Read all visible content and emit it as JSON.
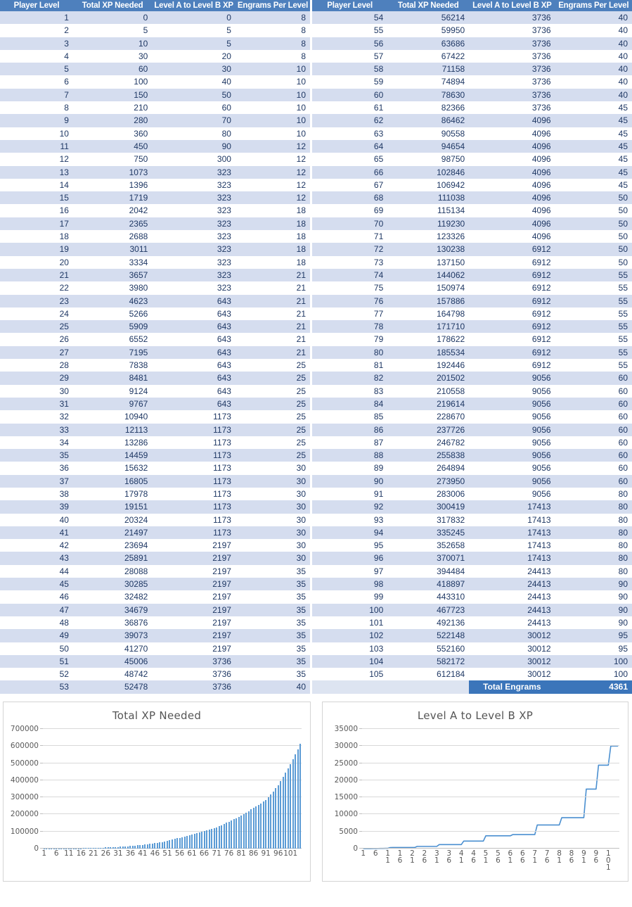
{
  "tables": {
    "headers": [
      "Player Level",
      "Total XP Needed",
      "Level A to Level B XP",
      "Engrams Per Level"
    ],
    "left_rows": [
      [
        1,
        0,
        0,
        8
      ],
      [
        2,
        5,
        5,
        8
      ],
      [
        3,
        10,
        5,
        8
      ],
      [
        4,
        30,
        20,
        8
      ],
      [
        5,
        60,
        30,
        10
      ],
      [
        6,
        100,
        40,
        10
      ],
      [
        7,
        150,
        50,
        10
      ],
      [
        8,
        210,
        60,
        10
      ],
      [
        9,
        280,
        70,
        10
      ],
      [
        10,
        360,
        80,
        10
      ],
      [
        11,
        450,
        90,
        12
      ],
      [
        12,
        750,
        300,
        12
      ],
      [
        13,
        1073,
        323,
        12
      ],
      [
        14,
        1396,
        323,
        12
      ],
      [
        15,
        1719,
        323,
        12
      ],
      [
        16,
        2042,
        323,
        18
      ],
      [
        17,
        2365,
        323,
        18
      ],
      [
        18,
        2688,
        323,
        18
      ],
      [
        19,
        3011,
        323,
        18
      ],
      [
        20,
        3334,
        323,
        18
      ],
      [
        21,
        3657,
        323,
        21
      ],
      [
        22,
        3980,
        323,
        21
      ],
      [
        23,
        4623,
        643,
        21
      ],
      [
        24,
        5266,
        643,
        21
      ],
      [
        25,
        5909,
        643,
        21
      ],
      [
        26,
        6552,
        643,
        21
      ],
      [
        27,
        7195,
        643,
        21
      ],
      [
        28,
        7838,
        643,
        25
      ],
      [
        29,
        8481,
        643,
        25
      ],
      [
        30,
        9124,
        643,
        25
      ],
      [
        31,
        9767,
        643,
        25
      ],
      [
        32,
        10940,
        1173,
        25
      ],
      [
        33,
        12113,
        1173,
        25
      ],
      [
        34,
        13286,
        1173,
        25
      ],
      [
        35,
        14459,
        1173,
        25
      ],
      [
        36,
        15632,
        1173,
        30
      ],
      [
        37,
        16805,
        1173,
        30
      ],
      [
        38,
        17978,
        1173,
        30
      ],
      [
        39,
        19151,
        1173,
        30
      ],
      [
        40,
        20324,
        1173,
        30
      ],
      [
        41,
        21497,
        1173,
        30
      ],
      [
        42,
        23694,
        2197,
        30
      ],
      [
        43,
        25891,
        2197,
        30
      ],
      [
        44,
        28088,
        2197,
        35
      ],
      [
        45,
        30285,
        2197,
        35
      ],
      [
        46,
        32482,
        2197,
        35
      ],
      [
        47,
        34679,
        2197,
        35
      ],
      [
        48,
        36876,
        2197,
        35
      ],
      [
        49,
        39073,
        2197,
        35
      ],
      [
        50,
        41270,
        2197,
        35
      ],
      [
        51,
        45006,
        3736,
        35
      ],
      [
        52,
        48742,
        3736,
        35
      ],
      [
        53,
        52478,
        3736,
        40
      ]
    ],
    "right_rows": [
      [
        54,
        56214,
        3736,
        40
      ],
      [
        55,
        59950,
        3736,
        40
      ],
      [
        56,
        63686,
        3736,
        40
      ],
      [
        57,
        67422,
        3736,
        40
      ],
      [
        58,
        71158,
        3736,
        40
      ],
      [
        59,
        74894,
        3736,
        40
      ],
      [
        60,
        78630,
        3736,
        40
      ],
      [
        61,
        82366,
        3736,
        45
      ],
      [
        62,
        86462,
        4096,
        45
      ],
      [
        63,
        90558,
        4096,
        45
      ],
      [
        64,
        94654,
        4096,
        45
      ],
      [
        65,
        98750,
        4096,
        45
      ],
      [
        66,
        102846,
        4096,
        45
      ],
      [
        67,
        106942,
        4096,
        45
      ],
      [
        68,
        111038,
        4096,
        50
      ],
      [
        69,
        115134,
        4096,
        50
      ],
      [
        70,
        119230,
        4096,
        50
      ],
      [
        71,
        123326,
        4096,
        50
      ],
      [
        72,
        130238,
        6912,
        50
      ],
      [
        73,
        137150,
        6912,
        50
      ],
      [
        74,
        144062,
        6912,
        55
      ],
      [
        75,
        150974,
        6912,
        55
      ],
      [
        76,
        157886,
        6912,
        55
      ],
      [
        77,
        164798,
        6912,
        55
      ],
      [
        78,
        171710,
        6912,
        55
      ],
      [
        79,
        178622,
        6912,
        55
      ],
      [
        80,
        185534,
        6912,
        55
      ],
      [
        81,
        192446,
        6912,
        55
      ],
      [
        82,
        201502,
        9056,
        60
      ],
      [
        83,
        210558,
        9056,
        60
      ],
      [
        84,
        219614,
        9056,
        60
      ],
      [
        85,
        228670,
        9056,
        60
      ],
      [
        86,
        237726,
        9056,
        60
      ],
      [
        87,
        246782,
        9056,
        60
      ],
      [
        88,
        255838,
        9056,
        60
      ],
      [
        89,
        264894,
        9056,
        60
      ],
      [
        90,
        273950,
        9056,
        60
      ],
      [
        91,
        283006,
        9056,
        80
      ],
      [
        92,
        300419,
        17413,
        80
      ],
      [
        93,
        317832,
        17413,
        80
      ],
      [
        94,
        335245,
        17413,
        80
      ],
      [
        95,
        352658,
        17413,
        80
      ],
      [
        96,
        370071,
        17413,
        80
      ],
      [
        97,
        394484,
        24413,
        80
      ],
      [
        98,
        418897,
        24413,
        90
      ],
      [
        99,
        443310,
        24413,
        90
      ],
      [
        100,
        467723,
        24413,
        90
      ],
      [
        101,
        492136,
        24413,
        90
      ],
      [
        102,
        522148,
        30012,
        95
      ],
      [
        103,
        552160,
        30012,
        95
      ],
      [
        104,
        582172,
        30012,
        100
      ],
      [
        105,
        612184,
        30012,
        100
      ]
    ],
    "total_label": "Total Engrams",
    "total_value": "4361",
    "header_bg": "#4e80bd",
    "row_alt_bg": "#d5ddef",
    "text_color": "#1f3864",
    "total_bg": "#3b75ba"
  },
  "chart_data": [
    {
      "type": "bar",
      "title": "Total XP Needed",
      "xlabel": "",
      "ylabel": "",
      "ylim": [
        0,
        700000
      ],
      "yticks": [
        0,
        100000,
        200000,
        300000,
        400000,
        500000,
        600000,
        700000
      ],
      "xticks": [
        1,
        6,
        11,
        16,
        21,
        26,
        31,
        36,
        41,
        46,
        51,
        56,
        61,
        66,
        71,
        76,
        81,
        86,
        91,
        96,
        101
      ],
      "grid": true,
      "legend": "none",
      "series_color": "#5b9bd5",
      "categories": [
        1,
        2,
        3,
        4,
        5,
        6,
        7,
        8,
        9,
        10,
        11,
        12,
        13,
        14,
        15,
        16,
        17,
        18,
        19,
        20,
        21,
        22,
        23,
        24,
        25,
        26,
        27,
        28,
        29,
        30,
        31,
        32,
        33,
        34,
        35,
        36,
        37,
        38,
        39,
        40,
        41,
        42,
        43,
        44,
        45,
        46,
        47,
        48,
        49,
        50,
        51,
        52,
        53,
        54,
        55,
        56,
        57,
        58,
        59,
        60,
        61,
        62,
        63,
        64,
        65,
        66,
        67,
        68,
        69,
        70,
        71,
        72,
        73,
        74,
        75,
        76,
        77,
        78,
        79,
        80,
        81,
        82,
        83,
        84,
        85,
        86,
        87,
        88,
        89,
        90,
        91,
        92,
        93,
        94,
        95,
        96,
        97,
        98,
        99,
        100,
        101,
        102,
        103,
        104,
        105
      ],
      "values": [
        0,
        5,
        10,
        30,
        60,
        100,
        150,
        210,
        280,
        360,
        450,
        750,
        1073,
        1396,
        1719,
        2042,
        2365,
        2688,
        3011,
        3334,
        3657,
        3980,
        4623,
        5266,
        5909,
        6552,
        7195,
        7838,
        8481,
        9124,
        9767,
        10940,
        12113,
        13286,
        14459,
        15632,
        16805,
        17978,
        19151,
        20324,
        21497,
        23694,
        25891,
        28088,
        30285,
        32482,
        34679,
        36876,
        39073,
        41270,
        45006,
        48742,
        52478,
        56214,
        59950,
        63686,
        67422,
        71158,
        74894,
        78630,
        82366,
        86462,
        90558,
        94654,
        98750,
        102846,
        106942,
        111038,
        115134,
        119230,
        123326,
        130238,
        137150,
        144062,
        150974,
        157886,
        164798,
        171710,
        178622,
        185534,
        192446,
        201502,
        210558,
        219614,
        228670,
        237726,
        246782,
        255838,
        264894,
        273950,
        283006,
        300419,
        317832,
        335245,
        352658,
        370071,
        394484,
        418897,
        443310,
        467723,
        492136,
        522148,
        552160,
        582172,
        612184
      ]
    },
    {
      "type": "line",
      "title": "Level A to Level B XP",
      "xlabel": "",
      "ylabel": "",
      "ylim": [
        0,
        35000
      ],
      "yticks": [
        0,
        5000,
        10000,
        15000,
        20000,
        25000,
        30000,
        35000
      ],
      "xticks": [
        1,
        6,
        11,
        16,
        21,
        26,
        31,
        36,
        41,
        46,
        51,
        56,
        61,
        66,
        71,
        76,
        81,
        86,
        91,
        96,
        101
      ],
      "grid": true,
      "legend": "none",
      "series_color": "#4a8fd0",
      "categories": [
        1,
        2,
        3,
        4,
        5,
        6,
        7,
        8,
        9,
        10,
        11,
        12,
        13,
        14,
        15,
        16,
        17,
        18,
        19,
        20,
        21,
        22,
        23,
        24,
        25,
        26,
        27,
        28,
        29,
        30,
        31,
        32,
        33,
        34,
        35,
        36,
        37,
        38,
        39,
        40,
        41,
        42,
        43,
        44,
        45,
        46,
        47,
        48,
        49,
        50,
        51,
        52,
        53,
        54,
        55,
        56,
        57,
        58,
        59,
        60,
        61,
        62,
        63,
        64,
        65,
        66,
        67,
        68,
        69,
        70,
        71,
        72,
        73,
        74,
        75,
        76,
        77,
        78,
        79,
        80,
        81,
        82,
        83,
        84,
        85,
        86,
        87,
        88,
        89,
        90,
        91,
        92,
        93,
        94,
        95,
        96,
        97,
        98,
        99,
        100,
        101,
        102,
        103,
        104,
        105
      ],
      "values": [
        0,
        5,
        5,
        20,
        30,
        40,
        50,
        60,
        70,
        80,
        90,
        300,
        323,
        323,
        323,
        323,
        323,
        323,
        323,
        323,
        323,
        323,
        643,
        643,
        643,
        643,
        643,
        643,
        643,
        643,
        643,
        1173,
        1173,
        1173,
        1173,
        1173,
        1173,
        1173,
        1173,
        1173,
        1173,
        2197,
        2197,
        2197,
        2197,
        2197,
        2197,
        2197,
        2197,
        2197,
        3736,
        3736,
        3736,
        3736,
        3736,
        3736,
        3736,
        3736,
        3736,
        3736,
        3736,
        4096,
        4096,
        4096,
        4096,
        4096,
        4096,
        4096,
        4096,
        4096,
        4096,
        6912,
        6912,
        6912,
        6912,
        6912,
        6912,
        6912,
        6912,
        6912,
        6912,
        9056,
        9056,
        9056,
        9056,
        9056,
        9056,
        9056,
        9056,
        9056,
        9056,
        17413,
        17413,
        17413,
        17413,
        17413,
        24413,
        24413,
        24413,
        24413,
        24413,
        30012,
        30012,
        30012,
        30012
      ]
    }
  ]
}
